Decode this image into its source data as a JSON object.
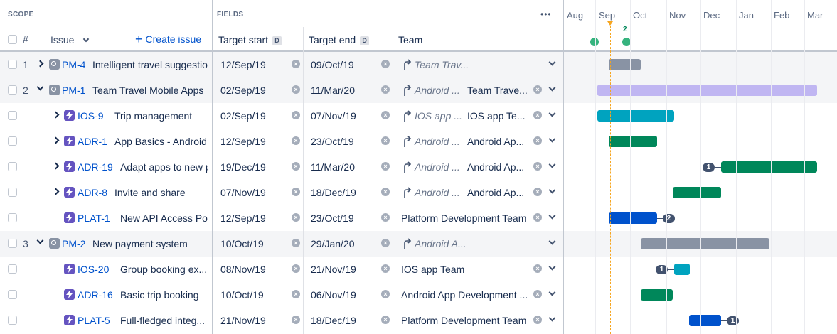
{
  "header": {
    "scope_label": "SCOPE",
    "fields_label": "FIELDS",
    "more_label": "•••",
    "num_label": "#",
    "issue_label": "Issue",
    "create_issue_label": "Create issue",
    "target_start_label": "Target start",
    "target_end_label": "Target end",
    "d_badge": "D",
    "team_label": "Team"
  },
  "timeline": {
    "months": [
      "Aug",
      "Sep",
      "Oct",
      "Nov",
      "Dec",
      "Jan",
      "Feb",
      "Mar"
    ],
    "marker_count": "2",
    "today_color": "#f6a51e",
    "marker_color": "#36b37e"
  },
  "rows": [
    {
      "num": "1",
      "key": "PM-4",
      "summary": "Intelligent travel suggestions",
      "start": "12/Sep/19",
      "end": "09/Oct/19",
      "team_italic": "Team Trav...",
      "team": "",
      "color": "#8993a4",
      "dep_left": "",
      "dep_right": ""
    },
    {
      "num": "2",
      "key": "PM-1",
      "summary": "Team Travel Mobile Apps",
      "start": "02/Sep/19",
      "end": "11/Mar/20",
      "team_italic": "Android ...",
      "team": "Team Trave...",
      "color": "#c0b6f2",
      "dep_left": "",
      "dep_right": ""
    },
    {
      "num": "",
      "key": "IOS-9",
      "summary": "Trip management",
      "start": "02/Sep/19",
      "end": "07/Nov/19",
      "team_italic": "IOS app ...",
      "team": "IOS app Te...",
      "color": "#00a3bf",
      "dep_left": "",
      "dep_right": ""
    },
    {
      "num": "",
      "key": "ADR-1",
      "summary": "App Basics - Android",
      "start": "12/Sep/19",
      "end": "23/Oct/19",
      "team_italic": "Android ...",
      "team": "Android Ap...",
      "color": "#00875a",
      "dep_left": "",
      "dep_right": ""
    },
    {
      "num": "",
      "key": "ADR-19",
      "summary": "Adapt apps to new payments",
      "start": "19/Dec/19",
      "end": "11/Mar/20",
      "team_italic": "Android ...",
      "team": "Android Ap...",
      "color": "#00875a",
      "dep_left": "1",
      "dep_right": ""
    },
    {
      "num": "",
      "key": "ADR-8",
      "summary": "Invite and share",
      "start": "07/Nov/19",
      "end": "18/Dec/19",
      "team_italic": "Android ...",
      "team": "Android Ap...",
      "color": "#00875a",
      "dep_left": "",
      "dep_right": ""
    },
    {
      "num": "",
      "key": "PLAT-1",
      "summary": "New API Access Point",
      "start": "12/Sep/19",
      "end": "23/Oct/19",
      "team_italic": "",
      "team": "Platform Development Team",
      "color": "#0052cc",
      "dep_left": "",
      "dep_right": "2"
    },
    {
      "num": "3",
      "key": "PM-2",
      "summary": "New payment system",
      "start": "10/Oct/19",
      "end": "29/Jan/20",
      "team_italic": "Android A...",
      "team": "",
      "color": "#8993a4",
      "dep_left": "",
      "dep_right": ""
    },
    {
      "num": "",
      "key": "IOS-20",
      "summary": "Group booking ex...",
      "start": "08/Nov/19",
      "end": "21/Nov/19",
      "team_italic": "",
      "team": "IOS app Team",
      "color": "#00a3bf",
      "dep_left": "1",
      "dep_right": ""
    },
    {
      "num": "",
      "key": "ADR-16",
      "summary": "Basic trip booking",
      "start": "10/Oct/19",
      "end": "06/Nov/19",
      "team_italic": "",
      "team": "Android App Development ...",
      "color": "#00875a",
      "dep_left": "",
      "dep_right": ""
    },
    {
      "num": "",
      "key": "PLAT-5",
      "summary": "Full-fledged integ...",
      "start": "21/Nov/19",
      "end": "18/Dec/19",
      "team_italic": "",
      "team": "Platform Development Team",
      "color": "#0052cc",
      "dep_left": "",
      "dep_right": "1"
    }
  ]
}
